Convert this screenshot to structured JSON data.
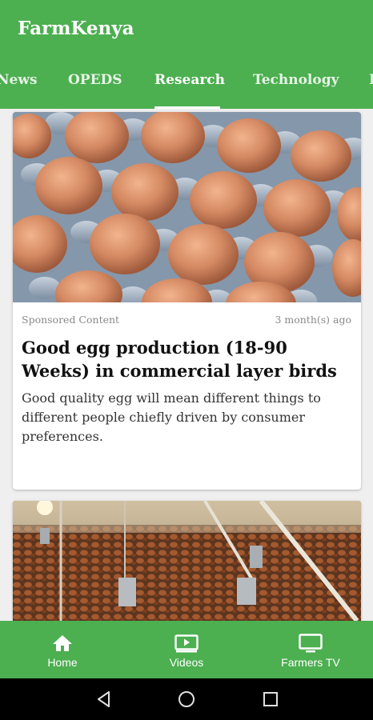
{
  "app": {
    "title": "FarmKenya"
  },
  "tabs": [
    {
      "label": "News"
    },
    {
      "label": "OPEDS"
    },
    {
      "label": "Research"
    },
    {
      "label": "Technology"
    },
    {
      "label": "I"
    }
  ],
  "active_tab": "Research",
  "articles": [
    {
      "category": "Sponsored Content",
      "age": "3 month(s) ago",
      "title": "Good egg production (18-90 Weeks) in commercial layer birds",
      "summary": "Good quality egg will mean different things to different people chiefly driven by consumer preferences.",
      "image": "brown-eggs-in-tray"
    },
    {
      "image": "poultry-house-hens"
    }
  ],
  "bottom_nav": {
    "items": [
      {
        "label": "Home",
        "icon": "home-icon"
      },
      {
        "label": "Videos",
        "icon": "video-icon"
      },
      {
        "label": "Farmers TV",
        "icon": "tv-icon"
      }
    ]
  },
  "system_nav": {
    "buttons": [
      "back-icon",
      "home-circle-icon",
      "recents-icon"
    ]
  },
  "colors": {
    "primary": "#4CAF50",
    "background": "#efefef",
    "system_bar": "#000000"
  }
}
